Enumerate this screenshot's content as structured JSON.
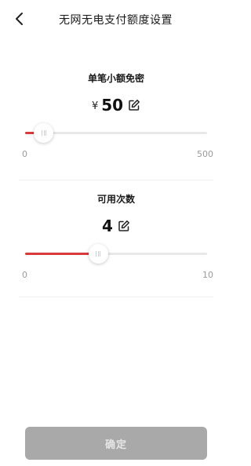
{
  "header": {
    "title": "无网无电支付额度设置"
  },
  "amount": {
    "label": "单笔小额免密",
    "currency": "¥",
    "value": "50",
    "min": "0",
    "max": "500",
    "level": 0.1
  },
  "count": {
    "label": "可用次数",
    "value": "4",
    "min": "0",
    "max": "10",
    "level": 0.4
  },
  "confirm_button": {
    "label": "确定"
  },
  "colors": {
    "accent": "#d93a3a",
    "track": "#e8e8e8",
    "button_disabled": "#a9a9a9"
  },
  "icons": {
    "back": "chevron-left-icon",
    "edit": "edit-pencil-icon"
  }
}
